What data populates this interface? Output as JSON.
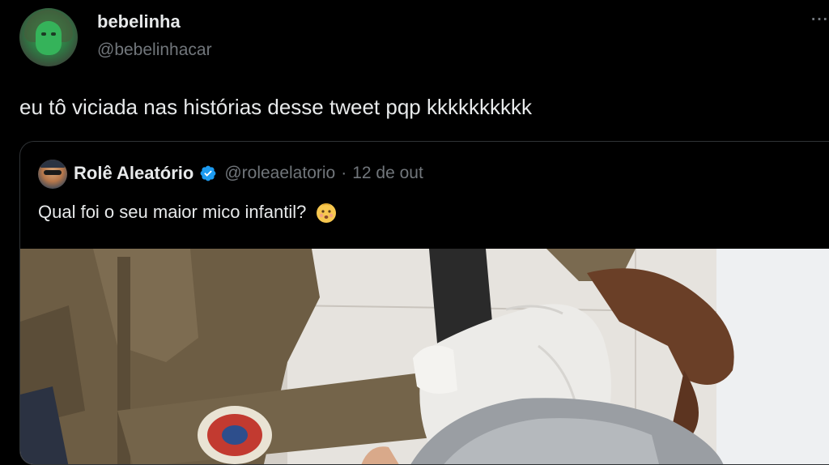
{
  "tweet": {
    "author_name": "bebelinha",
    "author_handle": "@bebelinhacar",
    "text": "eu tô viciada nas histórias desse tweet pqp kkkkkkkkkk",
    "more_icon": "more-horizontal-icon"
  },
  "quoted_tweet": {
    "author_name": "Rolê Aleatório",
    "verified": true,
    "author_handle": "@roleaelatorio",
    "separator": "·",
    "date": "12 de out",
    "text": "Qual foi o seu maior mico infantil?",
    "emoji_icon": "baby-face-emoji-icon",
    "media_description_icon": "photo-media"
  },
  "colors": {
    "background": "#000000",
    "primary_text": "#e7e9ea",
    "secondary_text": "#71767b",
    "border": "#2f3336",
    "verified_blue": "#1d9bf0"
  }
}
